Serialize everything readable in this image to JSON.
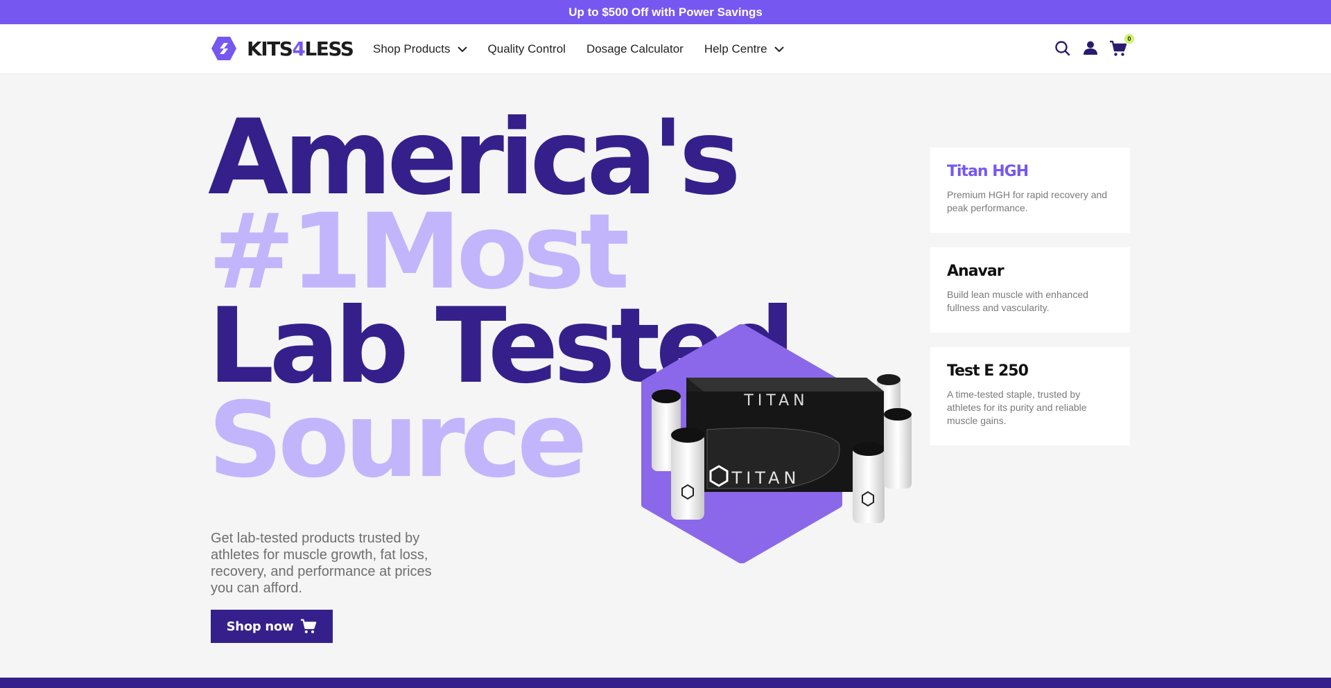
{
  "announcement": "Up to $500 Off with Power Savings",
  "logo": {
    "prefix": "KITS",
    "accent": "4",
    "suffix": "LESS"
  },
  "nav": [
    {
      "label": "Shop Products",
      "dropdown": true
    },
    {
      "label": "Quality Control",
      "dropdown": false
    },
    {
      "label": "Dosage Calculator",
      "dropdown": false
    },
    {
      "label": "Help Centre",
      "dropdown": true
    }
  ],
  "header_icons": [
    "search-icon",
    "user-icon",
    "cart-icon"
  ],
  "cart_count": "0",
  "hero": {
    "line1": "America's",
    "line2": "#1Most",
    "line3": "Lab Tested",
    "line4": "Source",
    "description": "Get lab-tested products trusted by athletes for muscle growth, fat loss, recovery, and performance at prices you can afford.",
    "cta": "Shop now",
    "product_brand": "TITAN"
  },
  "cards": [
    {
      "title": "Titan HGH",
      "desc": "Premium HGH for rapid recovery and peak performance.",
      "active": true
    },
    {
      "title": "Anavar",
      "desc": "Build lean muscle with enhanced fullness and vascularity.",
      "active": false
    },
    {
      "title": "Test E 250",
      "desc": "A time-tested staple, trusted by athletes for its purity and reliable muscle gains.",
      "active": false
    }
  ],
  "colors": {
    "accent": "#7658f0",
    "dark_purple": "#35208b",
    "light_purple": "#c3b5fb",
    "badge": "#cdf26c"
  }
}
